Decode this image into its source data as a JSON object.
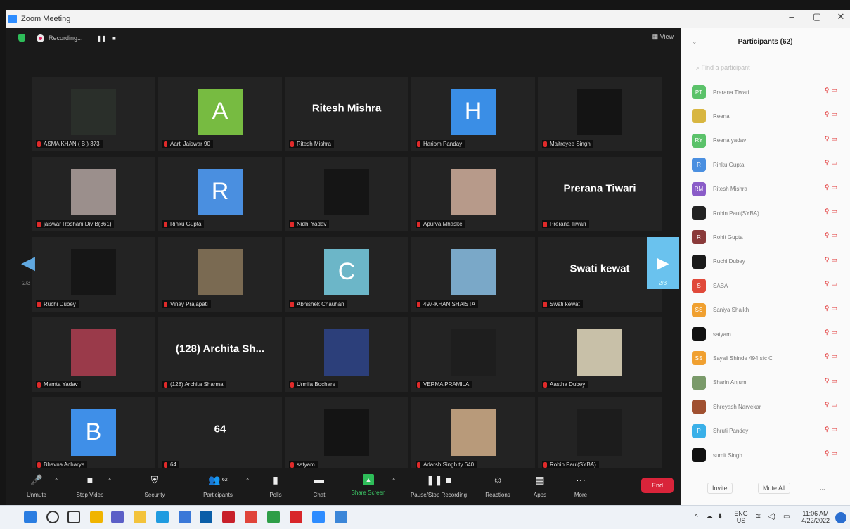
{
  "window": {
    "title": "Zoom Meeting",
    "minimize": "–",
    "maximize": "▢",
    "close": "✕"
  },
  "meeting_top": {
    "recording_label": "Recording...",
    "pause": "❚❚",
    "stop": "■",
    "view_label": "View"
  },
  "tiles": [
    {
      "name": "ASMA KHAN ( B ) 373",
      "kind": "image",
      "color": "#2a2f2a"
    },
    {
      "name": "Aarti Jaiswar 90",
      "kind": "letter",
      "letter": "A",
      "color": "#77bb41"
    },
    {
      "name": "Ritesh Mishra",
      "kind": "text",
      "big": "Ritesh Mishra"
    },
    {
      "name": "Hariom Panday",
      "kind": "letter",
      "letter": "H",
      "color": "#3a8ee6"
    },
    {
      "name": "Maitreyee Singh",
      "kind": "image",
      "color": "#141414"
    },
    {
      "name": "jaiswar Roshani Div:B(361)",
      "kind": "image",
      "color": "#9b8f8c"
    },
    {
      "name": "Rinku Gupta",
      "kind": "letter",
      "letter": "R",
      "color": "#4a8fe0"
    },
    {
      "name": "Nidhi Yadav",
      "kind": "image",
      "color": "#151515"
    },
    {
      "name": "Apurva Mhaske",
      "kind": "image",
      "color": "#b79a8a"
    },
    {
      "name": "Prerana Tiwari",
      "kind": "text",
      "big": "Prerana Tiwari"
    },
    {
      "name": "Ruchi Dubey",
      "kind": "image",
      "color": "#161616"
    },
    {
      "name": "Vinay Prajapati",
      "kind": "image",
      "color": "#7a6a52"
    },
    {
      "name": "Abhishek Chauhan",
      "kind": "letter",
      "letter": "C",
      "color": "#6cb6c8"
    },
    {
      "name": "497-KHAN SHAISTA",
      "kind": "image",
      "color": "#7aa8c8"
    },
    {
      "name": "Swati kewat",
      "kind": "text",
      "big": "Swati kewat"
    },
    {
      "name": "Mamta Yadav",
      "kind": "image",
      "color": "#9a3a4a"
    },
    {
      "name": "(128) Archita Sharma",
      "kind": "text",
      "big": "(128) Archita Sh..."
    },
    {
      "name": "Urmila Bochare",
      "kind": "image",
      "color": "#2c3f7a"
    },
    {
      "name": "VERMA PRAMILA",
      "kind": "image",
      "color": "#1e1e1e"
    },
    {
      "name": "Aastha Dubey",
      "kind": "image",
      "color": "#c8c0a8"
    },
    {
      "name": "Bhavna Acharya",
      "kind": "letter",
      "letter": "B",
      "color": "#3f8fe8"
    },
    {
      "name": "64",
      "kind": "text",
      "big": "64"
    },
    {
      "name": "satyam",
      "kind": "image",
      "color": "#141414"
    },
    {
      "name": "Adarsh Singh ty 640",
      "kind": "image",
      "color": "#b89a7a"
    },
    {
      "name": "Robin Paul(SYBA)",
      "kind": "image",
      "color": "#1c1c1c"
    }
  ],
  "pagination": {
    "left": "2/3",
    "right": "2/3"
  },
  "controls": [
    {
      "label": "Unmute",
      "icon": "mic-muted-icon",
      "glyph": "🎤"
    },
    {
      "label": "Stop Video",
      "icon": "video-camera-icon",
      "glyph": "■"
    },
    {
      "label": "Security",
      "icon": "shield-icon",
      "glyph": "⛨"
    },
    {
      "label": "Participants",
      "icon": "participants-icon",
      "glyph": "👥",
      "badge": "62"
    },
    {
      "label": "Polls",
      "icon": "polls-icon",
      "glyph": "▮"
    },
    {
      "label": "Chat",
      "icon": "chat-icon",
      "glyph": "▬"
    },
    {
      "label": "Share Screen",
      "icon": "share-screen-icon",
      "glyph": "▲"
    },
    {
      "label": "Pause/Stop Recording",
      "icon": "pause-recording-icon",
      "glyph": "❚❚ ■"
    },
    {
      "label": "Reactions",
      "icon": "reactions-icon",
      "glyph": "☺"
    },
    {
      "label": "Apps",
      "icon": "apps-icon",
      "glyph": "▦"
    },
    {
      "label": "More",
      "icon": "more-icon",
      "glyph": "···"
    }
  ],
  "end_label": "End",
  "participants_panel": {
    "title": "Participants (62)",
    "search_placeholder": "Find a participant",
    "items": [
      {
        "initials": "PT",
        "name": "Prerana Tiwari",
        "color": "#5bc26a"
      },
      {
        "initials": "",
        "name": "Reena",
        "color": "#d8b640"
      },
      {
        "initials": "RY",
        "name": "Reena yadav",
        "color": "#5bc26a"
      },
      {
        "initials": "R",
        "name": "Rinku Gupta",
        "color": "#4a8fe0"
      },
      {
        "initials": "RM",
        "name": "Ritesh Mishra",
        "color": "#8a5cc8"
      },
      {
        "initials": "",
        "name": "Robin Paul(SYBA)",
        "color": "#222222"
      },
      {
        "initials": "R",
        "name": "Rohit Gupta",
        "color": "#8a3a3a"
      },
      {
        "initials": "",
        "name": "Ruchi Dubey",
        "color": "#1a1a1a"
      },
      {
        "initials": "S",
        "name": "SABA",
        "color": "#e0493a"
      },
      {
        "initials": "SS",
        "name": "Saniya Shaikh",
        "color": "#f0a030"
      },
      {
        "initials": "",
        "name": "satyam",
        "color": "#111111"
      },
      {
        "initials": "SS",
        "name": "Sayali Shinde 494 sfc C",
        "color": "#f0a030"
      },
      {
        "initials": "",
        "name": "Sharin Anjum",
        "color": "#7a9a6a"
      },
      {
        "initials": "",
        "name": "Shreyash Narvekar",
        "color": "#a05030"
      },
      {
        "initials": "P",
        "name": "Shruti Pandey",
        "color": "#3ab0e8"
      },
      {
        "initials": "",
        "name": "sumit Singh",
        "color": "#111111"
      }
    ],
    "invite_label": "Invite",
    "mute_all_label": "Mute All",
    "more_label": "..."
  },
  "taskbar": {
    "apps": [
      {
        "icon": "windows-start-icon",
        "color": "#2a7de1"
      },
      {
        "icon": "search-icon",
        "color": "#333333"
      },
      {
        "icon": "task-view-icon",
        "color": "#333333"
      },
      {
        "icon": "widgets-icon",
        "color": "#f0b400"
      },
      {
        "icon": "chat-app-icon",
        "color": "#5b5fc7"
      },
      {
        "icon": "file-explorer-icon",
        "color": "#f3c33b"
      },
      {
        "icon": "edge-icon",
        "color": "#1f9be0"
      },
      {
        "icon": "store-icon",
        "color": "#3a78d8"
      },
      {
        "icon": "dell-icon",
        "color": "#0a5ea8"
      },
      {
        "icon": "mcafee-icon",
        "color": "#c8202a"
      },
      {
        "icon": "chrome-icon",
        "color": "#e0443a"
      },
      {
        "icon": "chrome-2-icon",
        "color": "#2e9e48"
      },
      {
        "icon": "acrobat-icon",
        "color": "#d8262a"
      },
      {
        "icon": "zoom-icon",
        "color": "#2d8cff"
      },
      {
        "icon": "chrome-3-icon",
        "color": "#3b86d8"
      }
    ],
    "lang_top": "ENG",
    "lang_bottom": "US",
    "time": "11:06 AM",
    "date": "4/22/2022"
  }
}
